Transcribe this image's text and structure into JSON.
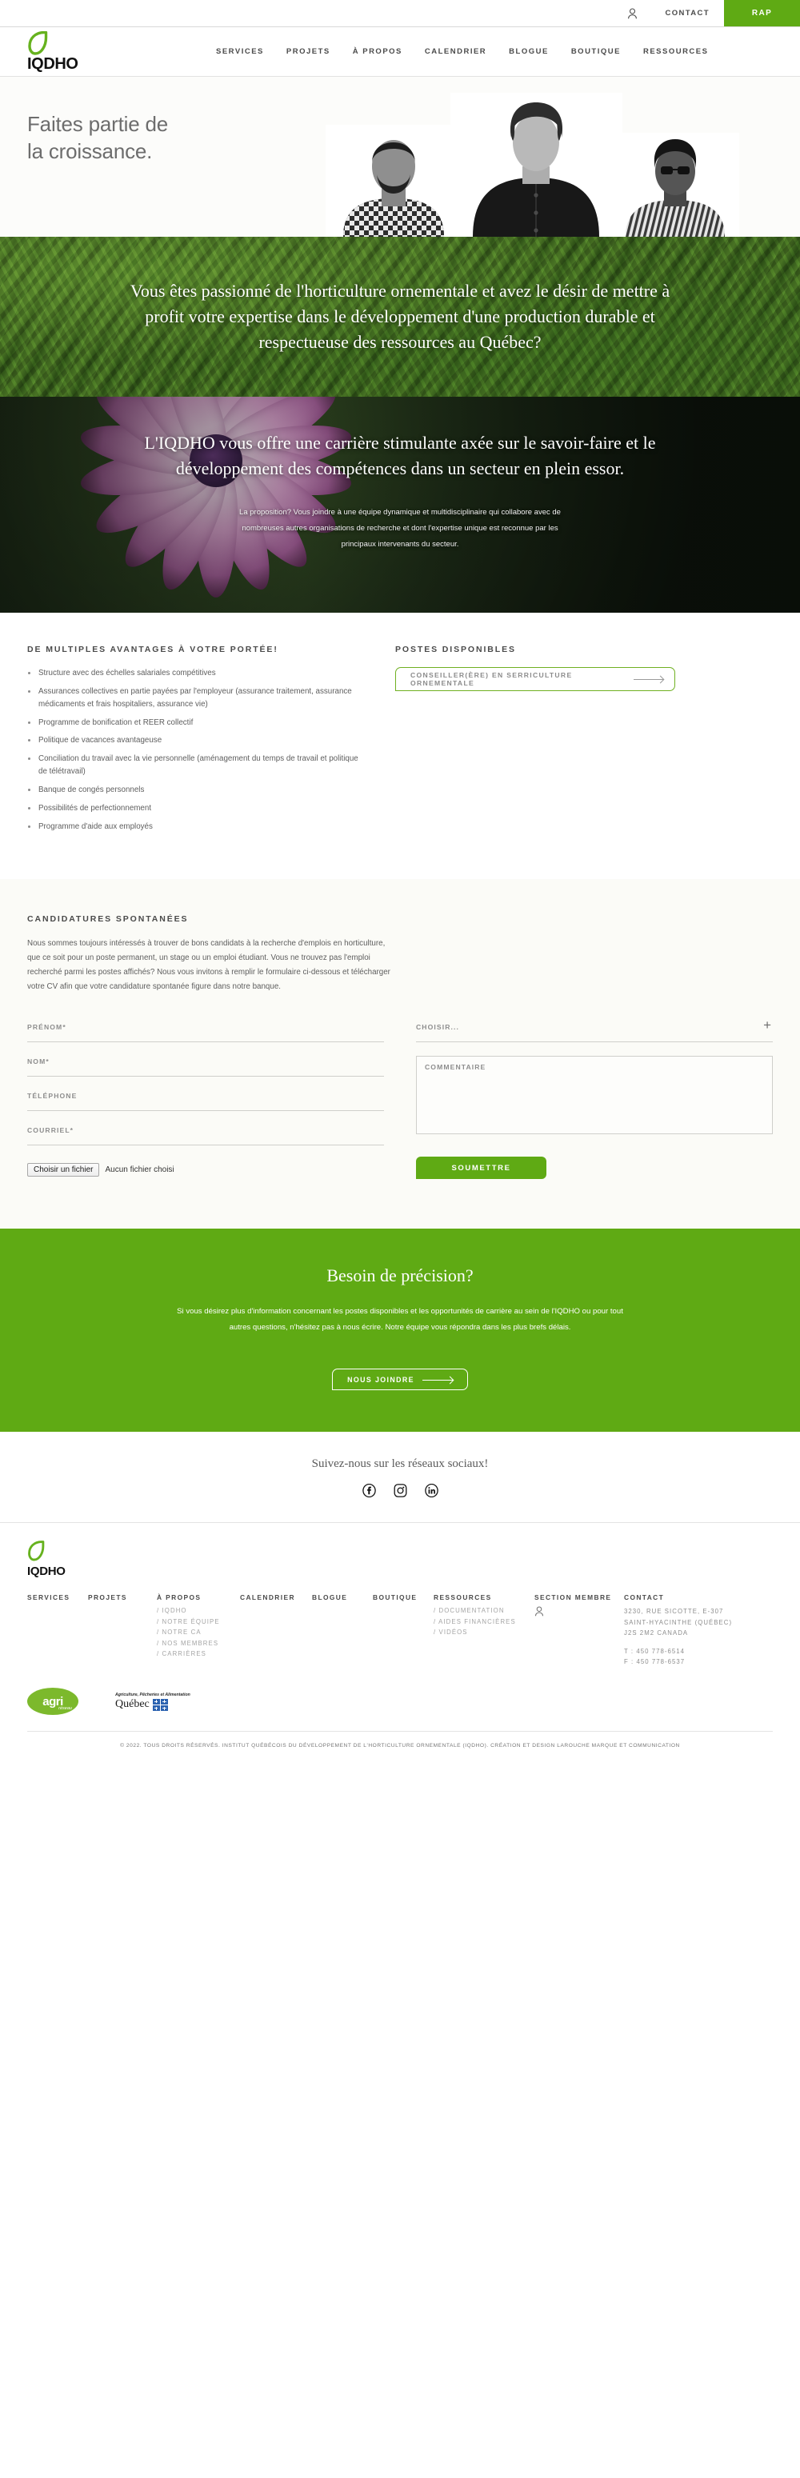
{
  "topbar": {
    "account_icon": "user-icon",
    "contact_label": "CONTACT",
    "rap_label": "RAP"
  },
  "brand": {
    "logo_text": "IQDHO",
    "logo_icon": "leaf-icon",
    "accent_green": "#5faa14"
  },
  "nav": {
    "items": [
      {
        "label": "SERVICES"
      },
      {
        "label": "PROJETS"
      },
      {
        "label": "À PROPOS"
      },
      {
        "label": "CALENDRIER"
      },
      {
        "label": "BLOGUE"
      },
      {
        "label": "BOUTIQUE"
      },
      {
        "label": "RESSOURCES"
      }
    ]
  },
  "hero": {
    "line1": "Faites partie de",
    "line2": "la croissance."
  },
  "band_foliage": {
    "text": "Vous êtes passionné de l'horticulture ornementale et avez le désir de mettre à profit votre expertise dans le développement d'une production durable et respectueuse des ressources au Québec?"
  },
  "band_flower": {
    "text": "L'IQDHO vous offre une carrière stimulante axée sur le savoir-faire et le développement des compétences dans un secteur en plein essor.",
    "sub": "La proposition? Vous joindre à une équipe dynamique et multidisciplinaire qui collabore avec de nombreuses autres organisations de recherche et dont l'expertise unique est reconnue par les principaux intervenants du secteur."
  },
  "advantages": {
    "title": "DE MULTIPLES AVANTAGES À VOTRE PORTÉE!",
    "items": [
      "Structure avec des échelles salariales compétitives",
      "Assurances collectives en partie payées par l'employeur (assurance traitement, assurance médicaments et frais hospitaliers, assurance vie)",
      "Programme de bonification et REER collectif",
      "Politique de vacances avantageuse",
      "Conciliation du travail avec la vie personnelle (aménagement du temps de travail et politique de télétravail)",
      "Banque de congés personnels",
      "Possibilités de perfectionnement",
      "Programme d'aide aux employés"
    ]
  },
  "jobs": {
    "title": "POSTES DISPONIBLES",
    "items": [
      {
        "label": "CONSEILLER(ÈRE) EN SERRICULTURE ORNEMENTALE"
      }
    ]
  },
  "applications": {
    "title": "CANDIDATURES SPONTANÉES",
    "intro": "Nous sommes toujours intéressés à trouver de bons candidats à la recherche d'emplois en horticulture, que ce soit pour un poste permanent, un stage ou un emploi étudiant. Vous ne trouvez pas l'emploi recherché parmi les postes affichés? Nous vous invitons à remplir le formulaire ci-dessous et télécharger votre CV afin que votre candidature spontanée figure dans notre banque.",
    "form": {
      "prenom_label": "PRÉNOM*",
      "prenom_value": "",
      "nom_label": "NOM*",
      "nom_value": "",
      "telephone_label": "TÉLÉPHONE",
      "telephone_value": "",
      "courriel_label": "COURRIEL*",
      "courriel_value": "",
      "file_button_label": "Choisir un fichier",
      "file_status": "Aucun fichier choisi",
      "select_label": "CHOISIR...",
      "select_icon": "plus-icon",
      "comment_label": "COMMENTAIRE",
      "comment_value": "",
      "submit_label": "SOUMETTRE"
    }
  },
  "cta": {
    "title": "Besoin de précision?",
    "body": "Si vous désirez plus d'information concernant les postes disponibles et les opportunités de carrière au sein de l'IQDHO ou pour tout autres questions, n'hésitez pas à nous écrire. Notre équipe vous répondra dans les plus brefs délais.",
    "button_label": "NOUS JOINDRE"
  },
  "social": {
    "title": "Suivez-nous sur les réseaux sociaux!",
    "items": [
      {
        "name": "facebook-icon",
        "glyph": "f"
      },
      {
        "name": "instagram-icon",
        "glyph": "◉"
      },
      {
        "name": "linkedin-icon",
        "glyph": "in"
      }
    ]
  },
  "footer": {
    "logo_text": "IQDHO",
    "columns": [
      {
        "title": "SERVICES",
        "links": []
      },
      {
        "title": "PROJETS",
        "links": []
      },
      {
        "title": "À PROPOS",
        "links": [
          "/ IQDHO",
          "/ NOTRE ÉQUIPE",
          "/ NOTRE CA",
          "/ NOS MEMBRES",
          "/ CARRIÈRES"
        ]
      },
      {
        "title": "CALENDRIER",
        "links": []
      },
      {
        "title": "BLOGUE",
        "links": []
      },
      {
        "title": "BOUTIQUE",
        "links": []
      },
      {
        "title": "RESSOURCES",
        "links": [
          "/ DOCUMENTATION",
          "/ AIDES FINANCIÈRES",
          "/ VIDÉOS"
        ]
      },
      {
        "title": "SECTION MEMBRE",
        "links": []
      }
    ],
    "contact": {
      "title": "CONTACT",
      "address1": "3230, RUE SICOTTE, E-307",
      "address2": "SAINT-HYACINTHE (QUÉBEC)",
      "address3": "J2S 2M2 CANADA",
      "phone": "T : 450 778-6514",
      "fax": "F : 450 778-6537"
    },
    "partners": {
      "agri_word": "agri",
      "agri_sub": "réseau",
      "quebec_top": "Agriculture, Pêcheries et Alimentation",
      "quebec_word": "Québec"
    },
    "copyright": "© 2022. TOUS DROITS RÉSERVÉS. INSTITUT QUÉBÉCOIS DU DÉVELOPPEMENT DE L'HORTICULTURE ORNEMENTALE (IQDHO). CRÉATION ET DESIGN LAROUCHE MARQUE ET COMMUNICATION"
  }
}
